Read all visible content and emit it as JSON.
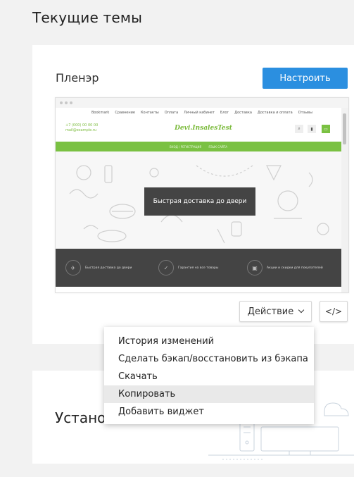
{
  "page": {
    "title": "Текущие темы"
  },
  "theme": {
    "name": "Пленэр",
    "configure_label": "Настроить",
    "action_label": "Действие",
    "code_label": "</>"
  },
  "preview": {
    "nav": [
      "Bookmark",
      "Сравнение",
      "Контакты",
      "Оплата",
      "Личный кабинет",
      "Блог",
      "Доставка",
      "Доставка и оплата",
      "Отзывы"
    ],
    "phone": "+7 (000) 00 00 00",
    "email": "mail@example.ru",
    "logo": "Devi.InsalesTest",
    "green_bar": [
      "ВХОД / РЕГИСТРАЦИЯ",
      "ЯЗЫК САЙТА"
    ],
    "cta": "Быстрая доставка до двери",
    "features": [
      "Быстрая доставка до двери",
      "Гарантия на все товары",
      "Акции и скидки для покупателей"
    ]
  },
  "installed": {
    "title": "Установленные темы"
  },
  "menu": {
    "items": [
      "История изменений",
      "Сделать бэкап/восстановить из бэкапа",
      "Скачать",
      "Копировать",
      "Добавить виджет"
    ]
  },
  "colors": {
    "accent": "#2b8fe0",
    "green": "#7ac142",
    "dark": "#444444",
    "menu_hover": "#e9e9e9"
  }
}
